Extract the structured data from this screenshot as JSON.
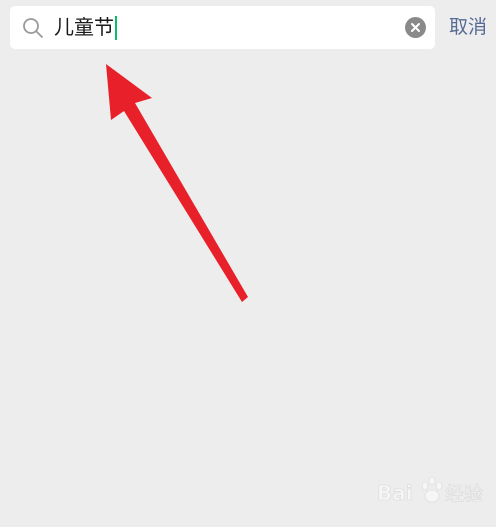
{
  "search": {
    "value": "儿童节",
    "icon": "search-icon",
    "clear_icon": "clear-icon",
    "caret_color": "#07c160"
  },
  "header": {
    "cancel_label": "取消",
    "cancel_color": "#576b95"
  },
  "annotation": {
    "arrow_color": "#e8202a"
  },
  "watermark": {
    "text": "Baidu经验"
  },
  "colors": {
    "background": "#ededed",
    "search_background": "#ffffff"
  }
}
